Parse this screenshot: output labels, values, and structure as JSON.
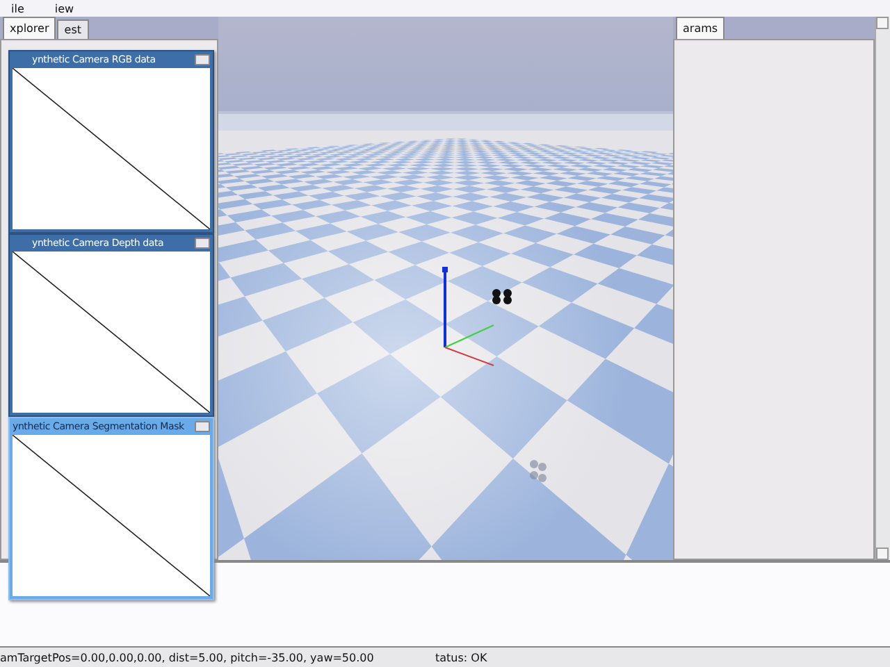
{
  "menu": [
    "ile",
    "iew"
  ],
  "left_tabs": [
    {
      "label": "xplorer",
      "selected": true
    },
    {
      "label": "est",
      "selected": false
    }
  ],
  "camera_windows": [
    {
      "title": "ynthetic Camera RGB data",
      "active": false
    },
    {
      "title": "ynthetic Camera Depth data",
      "active": false
    },
    {
      "title": "ynthetic Camera Segmentation Mask",
      "active": true
    }
  ],
  "right_tabs": [
    {
      "label": "arams",
      "selected": true
    }
  ],
  "status_bar": {
    "camera": "amTargetPos=0.00,0.00,0.00, dist=5.00, pitch=-35.00, yaw=50.00",
    "status": "tatus: OK"
  }
}
